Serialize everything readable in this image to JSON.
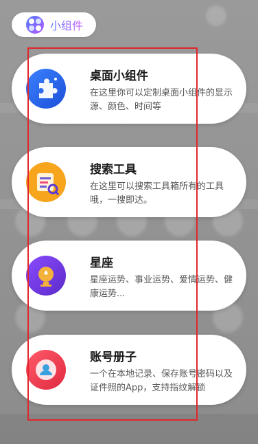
{
  "header": {
    "icon": "widget-logo-icon",
    "label": "小组件"
  },
  "cards": [
    {
      "title": "桌面小组件",
      "desc": "在这里你可以定制桌面小组件的显示源、颜色、时间等",
      "icon": "puzzle-icon",
      "color": "#2a63f2"
    },
    {
      "title": "搜索工具",
      "desc": "在这里可以搜索工具箱所有的工具哦，一搜即达。",
      "icon": "search-document-icon",
      "color": "#f7a51d"
    },
    {
      "title": "星座",
      "desc": "星座运势、事业运势、爱情运势、健康运势...",
      "icon": "constellation-globe-icon",
      "color": "#7a3fe0"
    },
    {
      "title": "账号册子",
      "desc": "一个在本地记录、保存账号密码以及证件照的App，支持指纹解锁",
      "icon": "account-book-icon",
      "color": "#ee3a4b"
    }
  ]
}
